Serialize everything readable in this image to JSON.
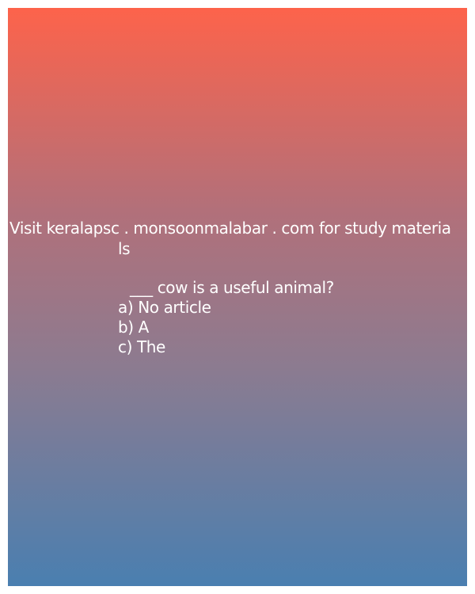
{
  "promo": {
    "line1": "Visit keralapsc . monsoonmalabar . com for study materia",
    "line2": "ls"
  },
  "question": {
    "text": " ___ cow is a useful animal?"
  },
  "options": [
    {
      "label": "a) No article"
    },
    {
      "label": "b) A"
    },
    {
      "label": "c) The"
    }
  ],
  "colors": {
    "gradient_top": "#fd634b",
    "gradient_bottom": "#4a7fb0",
    "text": "#ffffff"
  }
}
